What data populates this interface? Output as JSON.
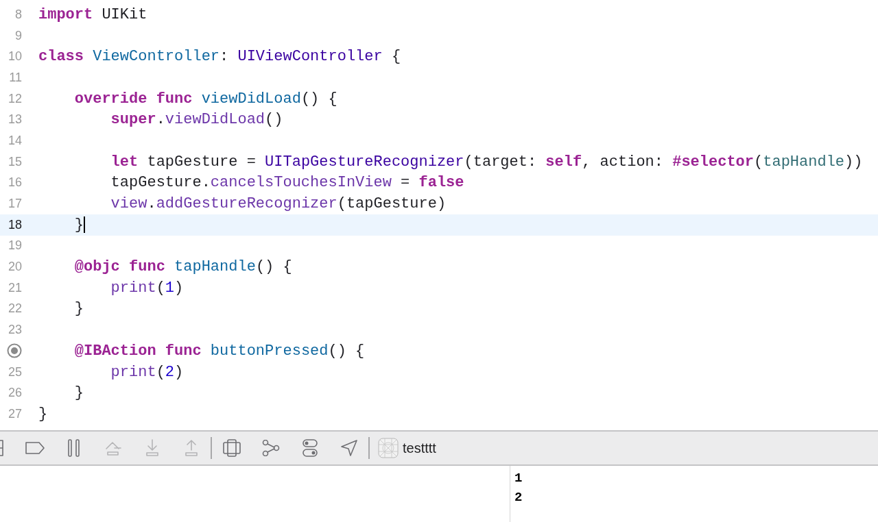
{
  "editor": {
    "lines": [
      {
        "number": "8",
        "tokens": [
          {
            "t": "import",
            "kind": "keyword"
          },
          {
            "t": " UIKit",
            "kind": "plain"
          }
        ]
      },
      {
        "number": "9"
      },
      {
        "number": "10",
        "tokens": [
          {
            "t": "class",
            "kind": "keyword"
          },
          {
            "t": " ViewController",
            "kind": "decl"
          },
          {
            "t": ": ",
            "kind": "plain"
          },
          {
            "t": "UIViewController",
            "kind": "type"
          },
          {
            "t": " {",
            "kind": "plain"
          }
        ]
      },
      {
        "number": "11"
      },
      {
        "number": "12",
        "tokens": [
          {
            "t": "    override",
            "kind": "keyword"
          },
          {
            "t": " func",
            "kind": "keyword"
          },
          {
            "t": " viewDidLoad",
            "kind": "decl"
          },
          {
            "t": "() {",
            "kind": "plain"
          }
        ]
      },
      {
        "number": "13",
        "tokens": [
          {
            "t": "        super",
            "kind": "keyword"
          },
          {
            "t": ".",
            "kind": "plain"
          },
          {
            "t": "viewDidLoad",
            "kind": "call"
          },
          {
            "t": "()",
            "kind": "plain"
          }
        ]
      },
      {
        "number": "14"
      },
      {
        "number": "15",
        "tokens": [
          {
            "t": "        let",
            "kind": "keyword"
          },
          {
            "t": " tapGesture = ",
            "kind": "plain"
          },
          {
            "t": "UITapGestureRecognizer",
            "kind": "type"
          },
          {
            "t": "(target: ",
            "kind": "plain"
          },
          {
            "t": "self",
            "kind": "keyword"
          },
          {
            "t": ", action: ",
            "kind": "plain"
          },
          {
            "t": "#selector",
            "kind": "keyword"
          },
          {
            "t": "(",
            "kind": "plain"
          },
          {
            "t": "tapHandle",
            "kind": "ref"
          },
          {
            "t": "))",
            "kind": "plain"
          }
        ]
      },
      {
        "number": "16",
        "tokens": [
          {
            "t": "        tapGesture.",
            "kind": "plain"
          },
          {
            "t": "cancelsTouchesInView",
            "kind": "call"
          },
          {
            "t": " = ",
            "kind": "plain"
          },
          {
            "t": "false",
            "kind": "keyword"
          }
        ]
      },
      {
        "number": "17",
        "tokens": [
          {
            "t": "        view",
            "kind": "call"
          },
          {
            "t": ".",
            "kind": "plain"
          },
          {
            "t": "addGestureRecognizer",
            "kind": "call"
          },
          {
            "t": "(tapGesture)",
            "kind": "plain"
          }
        ]
      },
      {
        "number": "18",
        "current": true,
        "tokens": [
          {
            "t": "    }",
            "kind": "plain"
          }
        ]
      },
      {
        "number": "19"
      },
      {
        "number": "20",
        "tokens": [
          {
            "t": "    @objc",
            "kind": "keyword"
          },
          {
            "t": " func",
            "kind": "keyword"
          },
          {
            "t": " tapHandle",
            "kind": "decl"
          },
          {
            "t": "() {",
            "kind": "plain"
          }
        ]
      },
      {
        "number": "21",
        "tokens": [
          {
            "t": "        print",
            "kind": "call"
          },
          {
            "t": "(",
            "kind": "plain"
          },
          {
            "t": "1",
            "kind": "number"
          },
          {
            "t": ")",
            "kind": "plain"
          }
        ]
      },
      {
        "number": "22",
        "tokens": [
          {
            "t": "    }",
            "kind": "plain"
          }
        ]
      },
      {
        "number": "23"
      },
      {
        "connection": true,
        "tokens": [
          {
            "t": "    @IBAction",
            "kind": "keyword"
          },
          {
            "t": " func",
            "kind": "keyword"
          },
          {
            "t": " buttonPressed",
            "kind": "decl"
          },
          {
            "t": "() {",
            "kind": "plain"
          }
        ]
      },
      {
        "number": "25",
        "tokens": [
          {
            "t": "        print",
            "kind": "call"
          },
          {
            "t": "(",
            "kind": "plain"
          },
          {
            "t": "2",
            "kind": "number"
          },
          {
            "t": ")",
            "kind": "plain"
          }
        ]
      },
      {
        "number": "26",
        "tokens": [
          {
            "t": "    }",
            "kind": "plain"
          }
        ]
      },
      {
        "number": "27",
        "tokens": [
          {
            "t": "}",
            "kind": "plain"
          }
        ]
      }
    ]
  },
  "debug_bar": {
    "items": [
      {
        "kind": "cut-device",
        "disabled": false
      },
      {
        "kind": "breakpoints",
        "disabled": false
      },
      {
        "kind": "pause",
        "disabled": false
      },
      {
        "kind": "step-over",
        "disabled": true
      },
      {
        "kind": "step-into",
        "disabled": true
      },
      {
        "kind": "step-out",
        "disabled": true
      },
      {
        "kind": "separator"
      },
      {
        "kind": "view-debugger",
        "disabled": false
      },
      {
        "kind": "memory-graph",
        "disabled": false
      },
      {
        "kind": "environment",
        "disabled": false
      },
      {
        "kind": "location",
        "disabled": false
      },
      {
        "kind": "separator"
      },
      {
        "kind": "app",
        "label": "testttt"
      }
    ]
  },
  "console": {
    "output": [
      "1",
      "2"
    ]
  }
}
